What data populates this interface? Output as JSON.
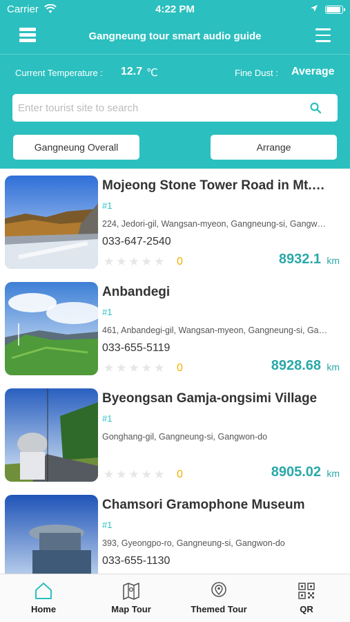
{
  "status": {
    "carrier": "Carrier",
    "time": "4:22 PM"
  },
  "header": {
    "title": "Gangneung tour smart audio guide"
  },
  "info": {
    "temp_label": "Current Temperature :",
    "temp_value": "12.7",
    "temp_unit": "℃",
    "dust_label": "Fine Dust :",
    "dust_value": "Average"
  },
  "search": {
    "placeholder": "Enter tourist site to search",
    "value": ""
  },
  "buttons": {
    "area": "Gangneung Overall",
    "arrange": "Arrange"
  },
  "places": [
    {
      "name": "Mojeong Stone Tower Road in Mt.…",
      "tag": "#1",
      "address": "224, Jedori-gil, Wangsan-myeon, Gangneung-si, Gangw…",
      "phone": "033-647-2540",
      "stars": "★★★★★",
      "rating": "0",
      "distance": "8932.1",
      "unit": "km"
    },
    {
      "name": "Anbandegi",
      "tag": "#1",
      "address": "461, Anbandegi-gil, Wangsan-myeon, Gangneung-si, Ga…",
      "phone": "033-655-5119",
      "stars": "★★★★★",
      "rating": "0",
      "distance": "8928.68",
      "unit": "km"
    },
    {
      "name": "Byeongsan Gamja-ongsimi Village",
      "tag": "#1",
      "address": "Gonghang-gil, Gangneung-si, Gangwon-do",
      "phone": "",
      "stars": "★★★★★",
      "rating": "0",
      "distance": "8905.02",
      "unit": "km"
    },
    {
      "name": "Chamsori Gramophone Museum",
      "tag": "#1",
      "address": "393, Gyeongpo-ro, Gangneung-si, Gangwon-do",
      "phone": "033-655-1130",
      "stars": "",
      "rating": "",
      "distance": "",
      "unit": ""
    }
  ],
  "tabs": [
    {
      "label": "Home",
      "icon": "home-icon"
    },
    {
      "label": "Map Tour",
      "icon": "map-icon"
    },
    {
      "label": "Themed Tour",
      "icon": "location-pin-icon"
    },
    {
      "label": "QR",
      "icon": "qr-code-icon"
    }
  ],
  "colors": {
    "primary": "#2bbfbf",
    "distance": "#2aa8a8",
    "rating": "#f0b000"
  }
}
